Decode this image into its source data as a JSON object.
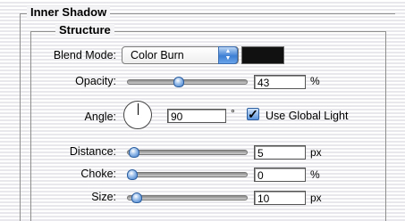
{
  "outer_group": {
    "title": "Inner Shadow"
  },
  "structure": {
    "title": "Structure",
    "blend_mode": {
      "label": "Blend Mode:",
      "value": "Color Burn",
      "color_swatch": "#111111"
    },
    "opacity": {
      "label": "Opacity:",
      "value": "43",
      "unit": "%",
      "level": 0.43
    },
    "angle": {
      "label": "Angle:",
      "value": "90",
      "unit": "°",
      "use_global_light": {
        "label": "Use Global Light",
        "checked": true
      }
    },
    "distance": {
      "label": "Distance:",
      "value": "5",
      "unit": "px",
      "level": 0.02
    },
    "choke": {
      "label": "Choke:",
      "value": "0",
      "unit": "%",
      "level": 0.0
    },
    "size": {
      "label": "Size:",
      "value": "10",
      "unit": "px",
      "level": 0.04
    }
  },
  "icons": {
    "dial": "angle-dial-icon",
    "checkmark": "checkmark-icon",
    "select_arrows": "up-down-arrows-icon"
  },
  "colors": {
    "accent": "#3a78c7",
    "swatch": "#111111"
  }
}
